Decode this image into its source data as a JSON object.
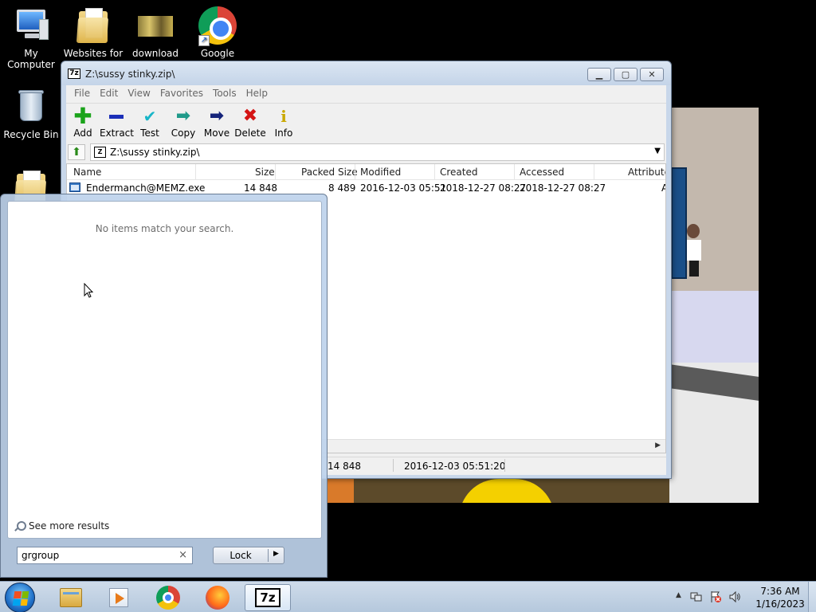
{
  "desktop": {
    "icons": [
      {
        "label": "My Computer",
        "icon": "computer-icon"
      },
      {
        "label": "Websites for",
        "icon": "folder-icon"
      },
      {
        "label": "download",
        "icon": "image-file-icon"
      },
      {
        "label": "Google",
        "icon": "chrome-icon"
      },
      {
        "label": "Recycle Bin",
        "icon": "recycle-bin-icon"
      },
      {
        "label": "",
        "icon": "folder-icon"
      }
    ]
  },
  "zip_window": {
    "title": "Z:\\sussy stinky.zip\\",
    "menu": [
      "File",
      "Edit",
      "View",
      "Favorites",
      "Tools",
      "Help"
    ],
    "toolbar": [
      {
        "label": "Add",
        "icon": "plus-icon",
        "color": "#1aa31a"
      },
      {
        "label": "Extract",
        "icon": "minus-icon",
        "color": "#1b2fb8"
      },
      {
        "label": "Test",
        "icon": "check-icon",
        "color": "#17b5c8"
      },
      {
        "label": "Copy",
        "icon": "copy-arrow-icon",
        "color": "#1f9a8a"
      },
      {
        "label": "Move",
        "icon": "move-arrow-icon",
        "color": "#14237a"
      },
      {
        "label": "Delete",
        "icon": "delete-x-icon",
        "color": "#d41414"
      },
      {
        "label": "Info",
        "icon": "info-icon",
        "color": "#c9a800"
      }
    ],
    "address": "Z:\\sussy stinky.zip\\",
    "columns": [
      "Name",
      "Size",
      "Packed Size",
      "Modified",
      "Created",
      "Accessed",
      "Attribute"
    ],
    "rows": [
      {
        "name": "Endermanch@MEMZ.exe",
        "size": "14 848",
        "packed": "8 489",
        "modified": "2016-12-03 05:51",
        "created": "2018-12-27 08:27",
        "accessed": "2018-12-27 08:27",
        "attr": "A"
      }
    ],
    "status": {
      "size": "14 848",
      "modified": "2016-12-03 05:51:20"
    }
  },
  "start_menu": {
    "no_items": "No items match your search.",
    "see_more": "See more results",
    "search_value": "grgroup",
    "lock_label": "Lock"
  },
  "taskbar": {
    "apps": [
      "windows-explorer-icon",
      "media-player-icon",
      "chrome-icon",
      "firefox-icon",
      "7zip-icon"
    ],
    "time": "7:36 AM",
    "date": "1/16/2023"
  }
}
